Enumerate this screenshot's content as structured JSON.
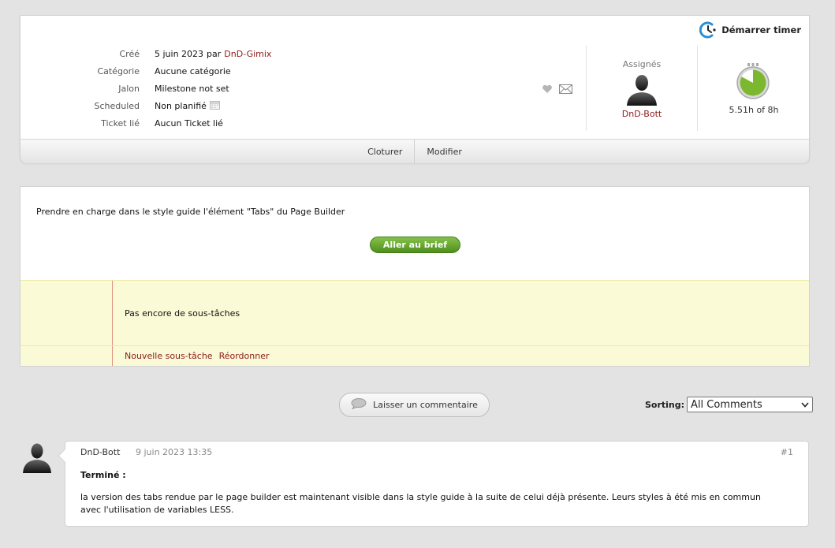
{
  "timer": {
    "label": "Démarrer timer"
  },
  "meta": {
    "created": {
      "label": "Créé",
      "date": "5 juin 2023",
      "by": "par",
      "author": "DnD-Gimix"
    },
    "category": {
      "label": "Catégorie",
      "value": "Aucune catégorie"
    },
    "milestone": {
      "label": "Jalon",
      "value": "Milestone not set"
    },
    "scheduled": {
      "label": "Scheduled",
      "value": "Non planifié"
    },
    "linked": {
      "label": "Ticket lié",
      "value": "Aucun Ticket lié"
    }
  },
  "assignees": {
    "label": "Assignés",
    "name": "DnD-Bott"
  },
  "time_tracking": {
    "text": "5.51h of 8h",
    "logged_hours": 5.51,
    "estimated_hours": 8
  },
  "actions": {
    "close": "Cloturer",
    "edit": "Modifier"
  },
  "description": {
    "text": "Prendre en charge dans le style guide l'élément \"Tabs\" du Page Builder",
    "brief_button": "Aller au brief"
  },
  "subtasks": {
    "empty": "Pas encore de sous-tâches",
    "new": "Nouvelle sous-tâche",
    "reorder": "Réordonner"
  },
  "comments_bar": {
    "leave_comment": "Laisser un commentaire",
    "sorting_label": "Sorting:",
    "sorting_value": "All Comments"
  },
  "comment": {
    "author": "DnD-Bott",
    "date": "9 juin 2023 13:35",
    "number": "#1",
    "title": "Terminé :",
    "body": "la version des tabs rendue par le page builder est maintenant visible dans la style guide à la suite de celui déjà présente. Leurs styles à été mis en commun avec l'utilisation de variables LESS."
  },
  "colors": {
    "link": "#8b1a1a",
    "brief_button": "#5a9a24",
    "subtask_bg": "#fbfad6",
    "timer_logo": "#2a8fd6"
  }
}
